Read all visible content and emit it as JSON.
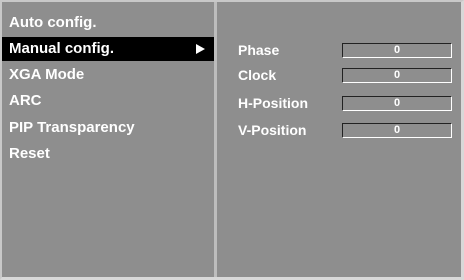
{
  "menu": {
    "items": [
      {
        "label": "Auto config."
      },
      {
        "label": "Manual config.",
        "selected": true,
        "submenu_indicator": "right-arrow-icon"
      },
      {
        "label": "XGA Mode"
      },
      {
        "label": "ARC"
      },
      {
        "label": "PIP Transparency"
      },
      {
        "label": "Reset"
      }
    ]
  },
  "manual_config": {
    "params": [
      {
        "label": "Phase",
        "value": "0"
      },
      {
        "label": "Clock",
        "value": "0"
      },
      {
        "label": "H-Position",
        "value": "0"
      },
      {
        "label": "V-Position",
        "value": "0"
      }
    ]
  },
  "colors": {
    "panel_background": "#8e8e8e",
    "selected_background": "#000000",
    "text": "#ffffff"
  }
}
